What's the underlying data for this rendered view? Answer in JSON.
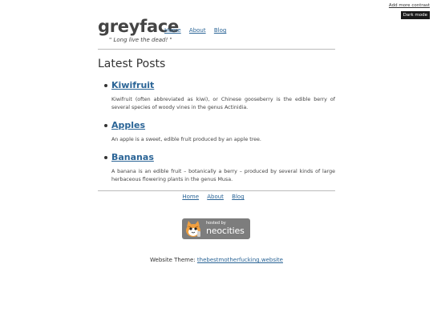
{
  "accessibility": {
    "contrast_link": "Add more contrast",
    "dark_mode_button": "Dark mode"
  },
  "header": {
    "title": "greyface",
    "tagline": "\" Long live the dead! \"",
    "nav": [
      "Home",
      "About",
      "Blog"
    ]
  },
  "main": {
    "section_title": "Latest Posts",
    "posts": [
      {
        "title": "Kiwifruit",
        "excerpt": "Kiwifruit (often abbreviated as kiwi), or Chinese gooseberry is the edible berry of several species of woody vines in the genus Actinidia."
      },
      {
        "title": "Apples",
        "excerpt": "An apple is a sweet, edible fruit produced by an apple tree."
      },
      {
        "title": "Bananas",
        "excerpt": "A banana is an edible fruit – botanically a berry – produced by several kinds of large herbaceous flowering plants in the genus Musa."
      }
    ]
  },
  "footer": {
    "nav": [
      "Home",
      "About",
      "Blog"
    ],
    "badge": {
      "small_text": "hosted by",
      "big_text": "neocities",
      "icon": "neocities-cat-icon"
    },
    "theme_label": "Website Theme: ",
    "theme_link": "thebestmotherfucking.website"
  },
  "colors": {
    "link": "#2a6496",
    "text": "#333333",
    "badge_bg": "#7d7d7d",
    "dark_button_bg": "#1a1a1a"
  }
}
